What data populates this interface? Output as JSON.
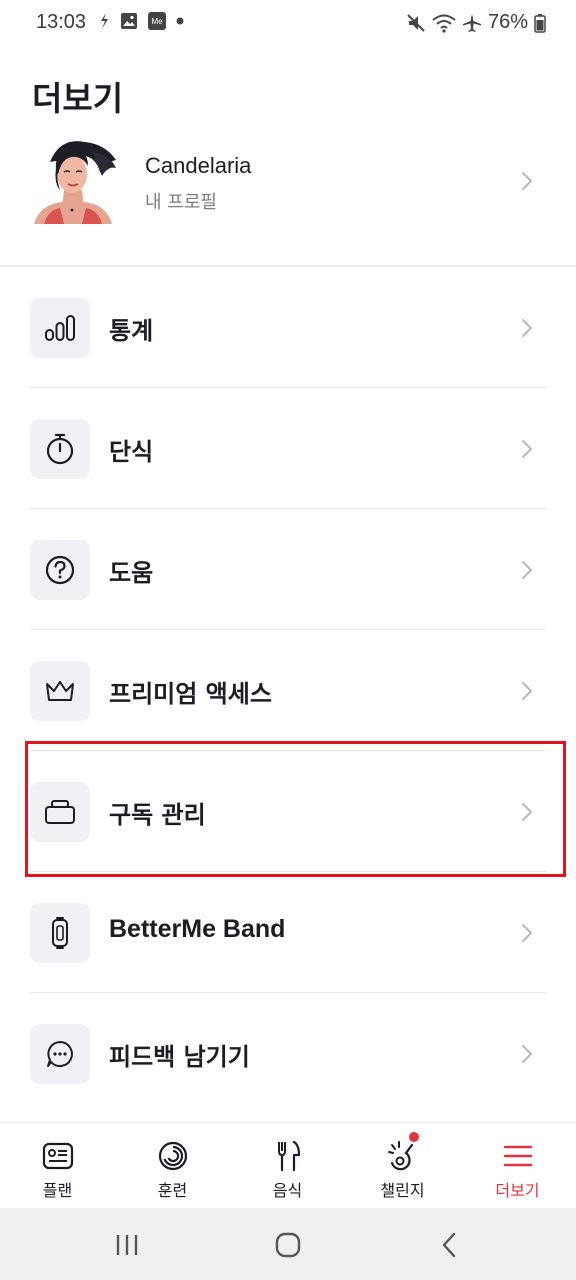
{
  "status_bar": {
    "time": "13:03",
    "battery": "76%",
    "left_icons": [
      "sync-icon",
      "image-icon",
      "me-app-icon",
      "dot-icon"
    ],
    "right_icons": [
      "mute-icon",
      "wifi-icon",
      "airplane-icon",
      "battery-icon"
    ],
    "me_badge": "Me"
  },
  "page": {
    "title": "더보기"
  },
  "profile": {
    "name": "Candelaria",
    "subtitle": "내 프로필"
  },
  "menu": {
    "items": [
      {
        "label": "통계",
        "icon": "stats-bars-icon"
      },
      {
        "label": "단식",
        "icon": "stopwatch-icon"
      },
      {
        "label": "도움",
        "icon": "help-icon"
      },
      {
        "label": "프리미엄 액세스",
        "icon": "crown-icon"
      },
      {
        "label": "구독 관리",
        "icon": "cards-stack-icon"
      },
      {
        "label": "BetterMe Band",
        "icon": "fitness-band-icon"
      },
      {
        "label": "피드백 남기기",
        "icon": "chat-bubble-icon"
      }
    ]
  },
  "bottom_nav": {
    "items": [
      {
        "label": "플랜",
        "icon": "plan-icon"
      },
      {
        "label": "훈련",
        "icon": "training-icon"
      },
      {
        "label": "음식",
        "icon": "fork-knife-icon"
      },
      {
        "label": "챌린지",
        "icon": "challenge-icon"
      },
      {
        "label": "더보기",
        "icon": "menu-icon"
      }
    ],
    "active": "더보기",
    "badge_on": "챌린지"
  },
  "colors": {
    "accent": "#e2343a",
    "highlight_border": "#e3121b",
    "icon_box": "#f1f1f5",
    "text": "#1c1c24"
  }
}
